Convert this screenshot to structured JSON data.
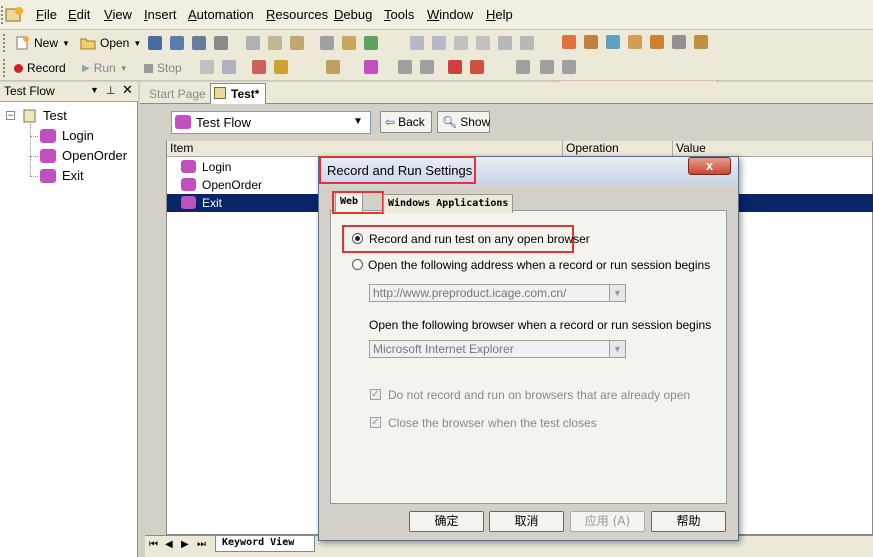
{
  "menu": [
    "File",
    "Edit",
    "View",
    "Insert",
    "Automation",
    "Resources",
    "Debug",
    "Tools",
    "Window",
    "Help"
  ],
  "toolbar1": {
    "new_label": "New",
    "open_label": "Open"
  },
  "toolbar2": {
    "record_label": "Record",
    "run_label": "Run",
    "stop_label": "Stop"
  },
  "left_panel": {
    "title": "Test Flow",
    "root": "Test",
    "items": [
      "Login",
      "OpenOrder",
      "Exit"
    ]
  },
  "tabs": {
    "start_page": "Start Page",
    "test": "Test*"
  },
  "flow_combo": {
    "value": "Test Flow"
  },
  "buttons": {
    "back": "Back",
    "show": "Show"
  },
  "grid": {
    "columns": [
      "Item",
      "Operation",
      "Value"
    ],
    "rows": [
      "Login",
      "OpenOrder",
      "Exit"
    ]
  },
  "bottom": {
    "keyword_view": "Keyword View"
  },
  "dialog": {
    "title": "Record and Run Settings",
    "close": "x",
    "tabs": [
      "Web",
      "Windows Applications"
    ],
    "option1": "Record and run test on any open browser",
    "option2": "Open the following address when a record or run session begins",
    "address_value": "http://www.preproduct.icage.com.cn/",
    "browser_label": "Open the following browser when a record or run session begins",
    "browser_value": "Microsoft Internet Explorer",
    "check1": "Do not record and run on browsers that are already open",
    "check2": "Close the browser when the test closes",
    "ok": "确定",
    "cancel": "取消",
    "apply": "应用 (A)",
    "help": "帮助"
  }
}
